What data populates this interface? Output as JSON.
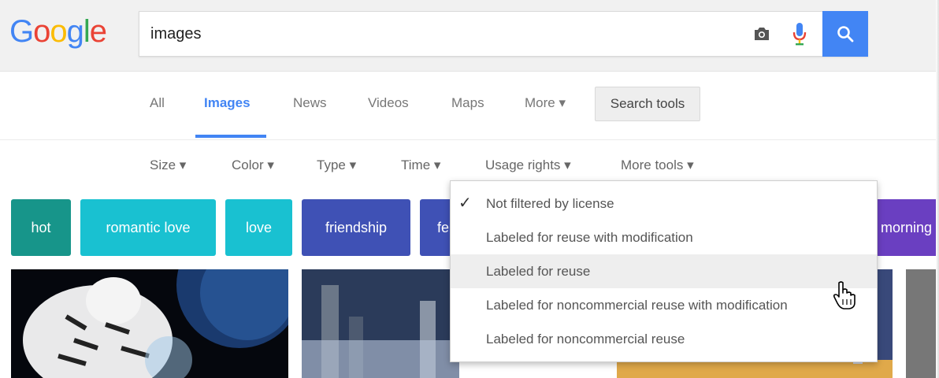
{
  "logo": {
    "letters": [
      "G",
      "o",
      "o",
      "g",
      "l",
      "e"
    ],
    "colors": [
      "#4285f4",
      "#ea4335",
      "#fbbc05",
      "#4285f4",
      "#34a853",
      "#ea4335"
    ]
  },
  "search": {
    "query": "images"
  },
  "icons": {
    "camera": "camera-icon",
    "mic": "microphone-icon",
    "search": "search-icon"
  },
  "tabs": [
    {
      "label": "All"
    },
    {
      "label": "Images",
      "active": true
    },
    {
      "label": "News"
    },
    {
      "label": "Videos"
    },
    {
      "label": "Maps"
    },
    {
      "label": "More ▾"
    }
  ],
  "search_tools_label": "Search tools",
  "tools": [
    {
      "label": "Size ▾"
    },
    {
      "label": "Color ▾"
    },
    {
      "label": "Type ▾"
    },
    {
      "label": "Time ▾"
    },
    {
      "label": "Usage rights ▾"
    },
    {
      "label": "More tools ▾"
    }
  ],
  "chips": [
    {
      "label": "hot",
      "color": "#17958a"
    },
    {
      "label": "romantic love",
      "color": "#19c1d1"
    },
    {
      "label": "love",
      "color": "#19c1d1"
    },
    {
      "label": "friendship",
      "color": "#3f51b5"
    },
    {
      "label": "fe",
      "color": "#3f51b5"
    },
    {
      "label": "morning",
      "color": "#6a3fc1"
    }
  ],
  "usage_menu": {
    "items": [
      {
        "label": "Not filtered by license",
        "checked": true
      },
      {
        "label": "Labeled for reuse with modification"
      },
      {
        "label": "Labeled for reuse",
        "hovered": true
      },
      {
        "label": "Labeled for noncommercial reuse with modification"
      },
      {
        "label": "Labeled for noncommercial reuse"
      }
    ],
    "check_glyph": "✓"
  }
}
